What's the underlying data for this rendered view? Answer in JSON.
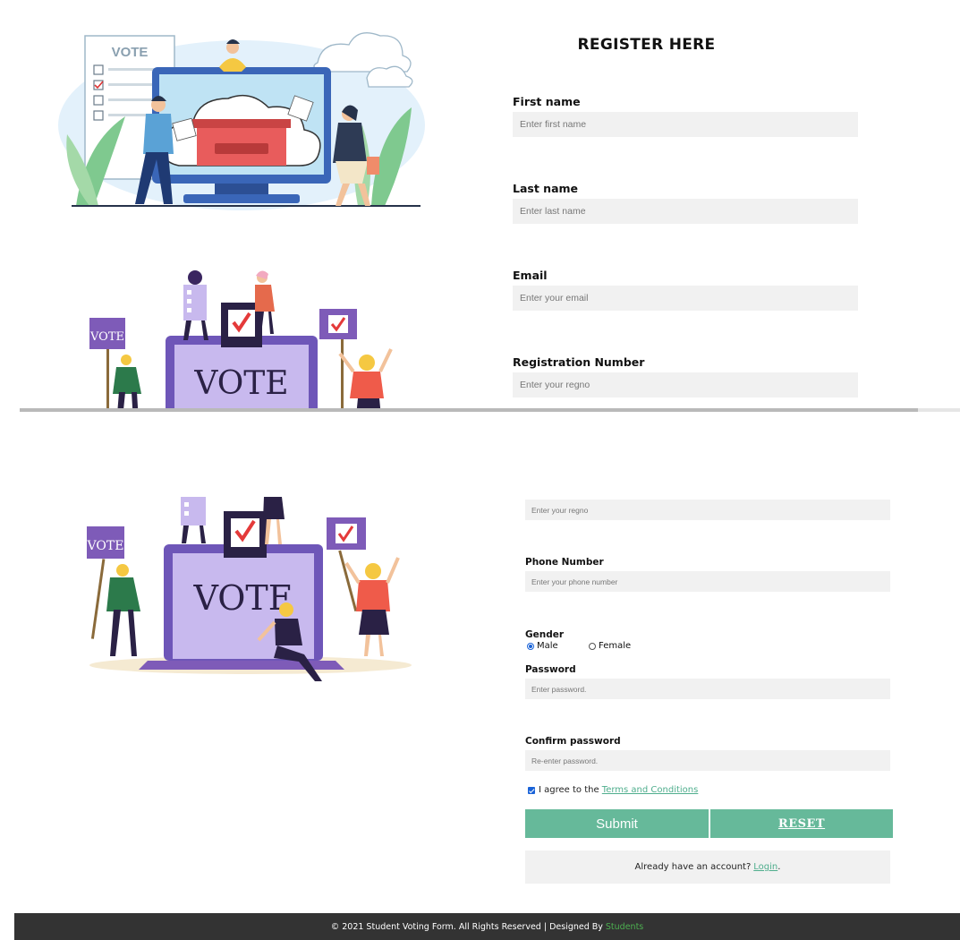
{
  "form": {
    "title": "REGISTER HERE",
    "fields": {
      "first_name": {
        "label": "First name",
        "placeholder": "Enter first name"
      },
      "last_name": {
        "label": "Last name",
        "placeholder": "Enter last name"
      },
      "email": {
        "label": "Email",
        "placeholder": "Enter your email"
      },
      "regno": {
        "label": "Registration Number",
        "placeholder": "Enter your regno"
      },
      "phone": {
        "label": "Phone Number",
        "placeholder": "Enter your phone number"
      },
      "password": {
        "label": "Password",
        "placeholder": "Enter password."
      },
      "confirm_password": {
        "label": "Confirm password",
        "placeholder": "Re-enter password."
      }
    },
    "gender": {
      "label": "Gender",
      "options": [
        "Male",
        "Female"
      ],
      "selected": "Male"
    },
    "terms": {
      "prefix": "I agree to the",
      "link": "Terms and Conditions",
      "checked": true
    },
    "buttons": {
      "submit": "Submit",
      "reset": "RESET"
    },
    "login": {
      "prefix": "Already have an account?",
      "link": "Login",
      "suffix": "."
    }
  },
  "illustrations": {
    "vote_sign": "VOTE"
  },
  "footer": {
    "text": "© 2021 Student Voting Form. All Rights Reserved | Designed By",
    "brand": "Students"
  },
  "colors": {
    "accent": "#66b99a",
    "link": "#4fae8d",
    "input_bg": "#f1f1f1",
    "footer_bg": "#333333",
    "footer_brand": "#4caf50",
    "radio_check": "#1a63d8"
  }
}
